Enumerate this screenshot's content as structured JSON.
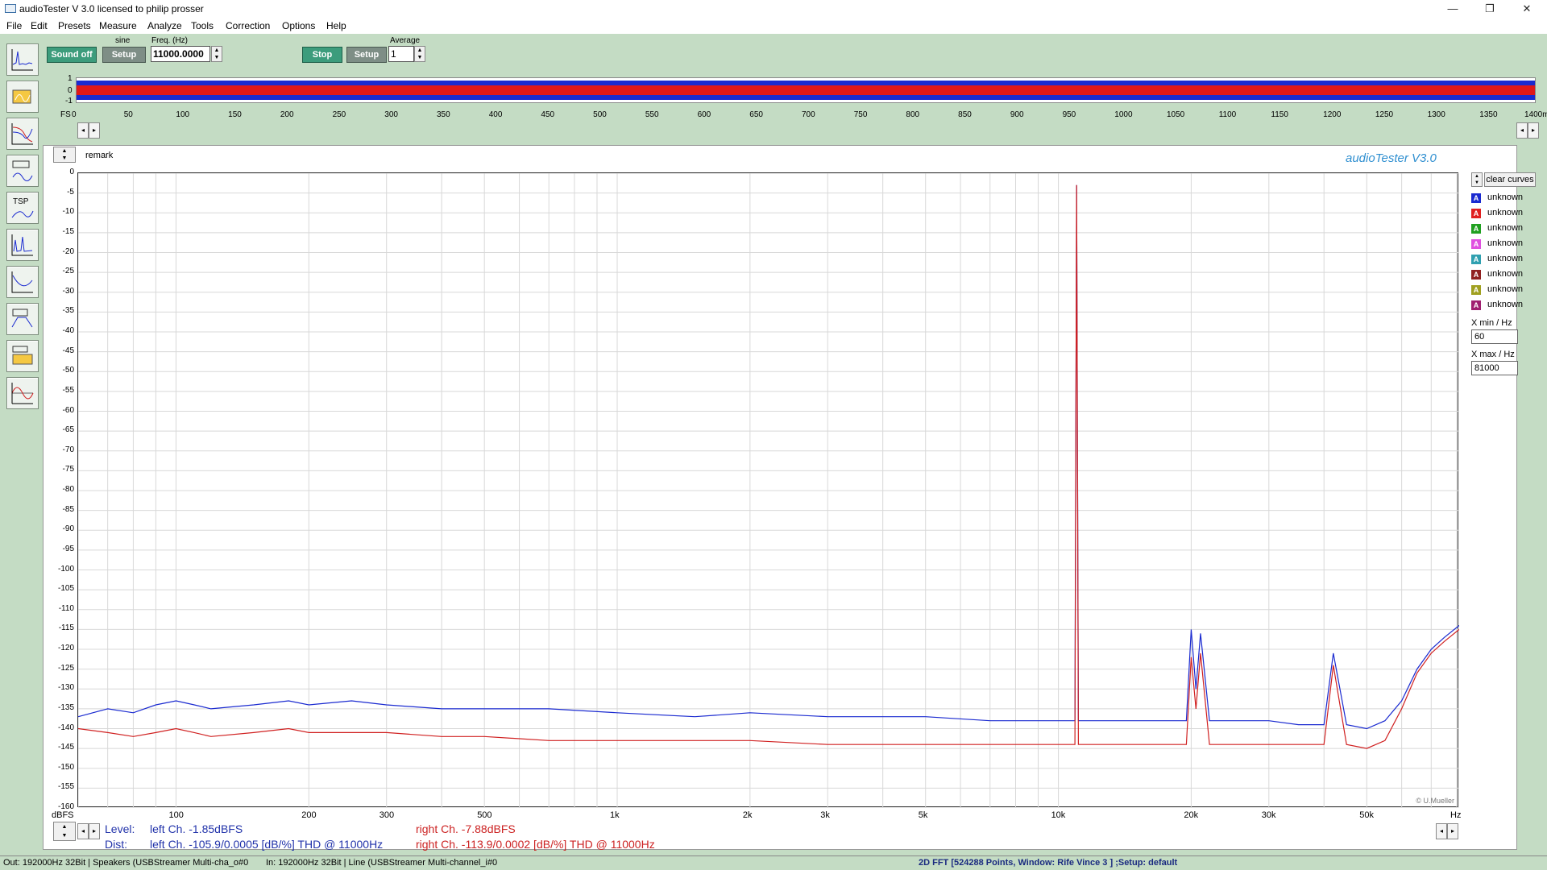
{
  "window": {
    "title": "audioTester  V 3.0   licensed to philip prosser",
    "minimize_icon": "—",
    "restore_icon": "❐",
    "close_icon": "✕"
  },
  "menu": {
    "file": "File",
    "edit": "Edit",
    "presets": "Presets",
    "measure": "Measure",
    "analyze": "Analyze",
    "tools": "Tools",
    "correction": "Correction",
    "options": "Options",
    "help": "Help"
  },
  "generator": {
    "sound_off_label": "Sound off",
    "waveform_label": "sine",
    "setup_label": "Setup",
    "freq_label": "Freq. (Hz)",
    "freq_value": "11000.0000"
  },
  "analyzer": {
    "stop_label": "Stop",
    "setup_label": "Setup",
    "average_label": "Average",
    "average_value": "1"
  },
  "strip": {
    "y_labels": [
      "1",
      "0",
      "-1"
    ],
    "fs_label": "FS",
    "x_labels": [
      "0",
      "50",
      "100",
      "150",
      "200",
      "250",
      "300",
      "350",
      "400",
      "450",
      "500",
      "550",
      "600",
      "650",
      "700",
      "750",
      "800",
      "850",
      "900",
      "950",
      "1000",
      "1050",
      "1100",
      "1150",
      "1200",
      "1250",
      "1300",
      "1350",
      "1400ms"
    ]
  },
  "remark_label": "remark",
  "brand": "audioTester  V3.0",
  "watermark": "© U.Mueller",
  "plot": {
    "y_unit": "dBFS",
    "x_unit": "Hz",
    "y_ticks": [
      "0",
      "-5",
      "-10",
      "-15",
      "-20",
      "-25",
      "-30",
      "-35",
      "-40",
      "-45",
      "-50",
      "-55",
      "-60",
      "-65",
      "-70",
      "-75",
      "-80",
      "-85",
      "-90",
      "-95",
      "-100",
      "-105",
      "-110",
      "-115",
      "-120",
      "-125",
      "-130",
      "-135",
      "-140",
      "-145",
      "-150",
      "-155",
      "-160"
    ],
    "x_ticks": [
      {
        "label": "100",
        "hz": 100
      },
      {
        "label": "200",
        "hz": 200
      },
      {
        "label": "300",
        "hz": 300
      },
      {
        "label": "500",
        "hz": 500
      },
      {
        "label": "1k",
        "hz": 1000
      },
      {
        "label": "2k",
        "hz": 2000
      },
      {
        "label": "3k",
        "hz": 3000
      },
      {
        "label": "5k",
        "hz": 5000
      },
      {
        "label": "10k",
        "hz": 10000
      },
      {
        "label": "20k",
        "hz": 20000
      },
      {
        "label": "30k",
        "hz": 30000
      },
      {
        "label": "50k",
        "hz": 50000
      }
    ]
  },
  "legend": {
    "clear_curves": "clear curves",
    "items": [
      {
        "badge": "A",
        "label": "unknown",
        "color": "#1a2ad0"
      },
      {
        "badge": "A",
        "label": "unknown",
        "color": "#e02020"
      },
      {
        "badge": "A",
        "label": "unknown",
        "color": "#20a020"
      },
      {
        "badge": "A",
        "label": "unknown",
        "color": "#e050e0"
      },
      {
        "badge": "A",
        "label": "unknown",
        "color": "#30a0b0"
      },
      {
        "badge": "A",
        "label": "unknown",
        "color": "#902020"
      },
      {
        "badge": "A",
        "label": "unknown",
        "color": "#a0a020"
      },
      {
        "badge": "A",
        "label": "unknown",
        "color": "#a02070"
      }
    ],
    "xmin_label": "X min / Hz",
    "xmin_value": "60",
    "xmax_label": "X max / Hz",
    "xmax_value": "81000"
  },
  "info": {
    "level_label": "Level:",
    "dist_label": "Dist:",
    "left_level": "left Ch. -1.85dBFS",
    "right_level": "right Ch. -7.88dBFS",
    "left_dist": "left Ch. -105.9/0.0005 [dB/%] THD @ 11000Hz",
    "right_dist": "right Ch. -113.9/0.0002 [dB/%] THD @ 11000Hz"
  },
  "status": {
    "out": "Out: 192000Hz 32Bit  | Speakers (USBStreamer Multi-cha_o#0",
    "in": "In: 192000Hz 32Bit  | Line (USBStreamer Multi-channel_i#0",
    "mode": "2D FFT [524288 Points, Window: Rife Vince 3 ] ;Setup:  default"
  },
  "chart_data": {
    "type": "line",
    "x_scale": "log",
    "xlim": [
      60,
      81000
    ],
    "ylim": [
      -160,
      0
    ],
    "xlabel": "Hz",
    "ylabel": "dBFS",
    "series": [
      {
        "color": "#1a2ad0",
        "x": [
          60,
          70,
          80,
          90,
          100,
          110,
          120,
          150,
          180,
          200,
          250,
          300,
          400,
          500,
          700,
          1000,
          1500,
          2000,
          3000,
          5000,
          7000,
          10000,
          10900,
          11000,
          11100,
          15000,
          19500,
          20000,
          20500,
          21000,
          22000,
          25000,
          28000,
          30000,
          35000,
          40000,
          42000,
          45000,
          50000,
          55000,
          60000,
          65000,
          70000,
          75000,
          81000
        ],
        "y": [
          -137,
          -135,
          -136,
          -134,
          -133,
          -134,
          -135,
          -134,
          -133,
          -134,
          -133,
          -134,
          -135,
          -135,
          -135,
          -136,
          -137,
          -136,
          -137,
          -137,
          -138,
          -138,
          -138,
          -3,
          -138,
          -138,
          -138,
          -115,
          -130,
          -116,
          -138,
          -138,
          -138,
          -138,
          -139,
          -139,
          -121,
          -139,
          -140,
          -138,
          -133,
          -125,
          -120,
          -117,
          -114
        ]
      },
      {
        "color": "#d02020",
        "x": [
          60,
          70,
          80,
          90,
          100,
          110,
          120,
          150,
          180,
          200,
          250,
          300,
          400,
          500,
          700,
          1000,
          1500,
          2000,
          3000,
          5000,
          7000,
          10000,
          10900,
          11000,
          11100,
          15000,
          19500,
          20000,
          20500,
          21000,
          22000,
          25000,
          28000,
          30000,
          35000,
          40000,
          42000,
          45000,
          50000,
          55000,
          60000,
          65000,
          70000,
          75000,
          81000
        ],
        "y": [
          -140,
          -141,
          -142,
          -141,
          -140,
          -141,
          -142,
          -141,
          -140,
          -141,
          -141,
          -141,
          -142,
          -142,
          -143,
          -143,
          -143,
          -143,
          -144,
          -144,
          -144,
          -144,
          -144,
          -3,
          -144,
          -144,
          -144,
          -122,
          -135,
          -121,
          -144,
          -144,
          -144,
          -144,
          -144,
          -144,
          -124,
          -144,
          -145,
          -143,
          -135,
          -126,
          -121,
          -118,
          -115
        ]
      }
    ]
  }
}
